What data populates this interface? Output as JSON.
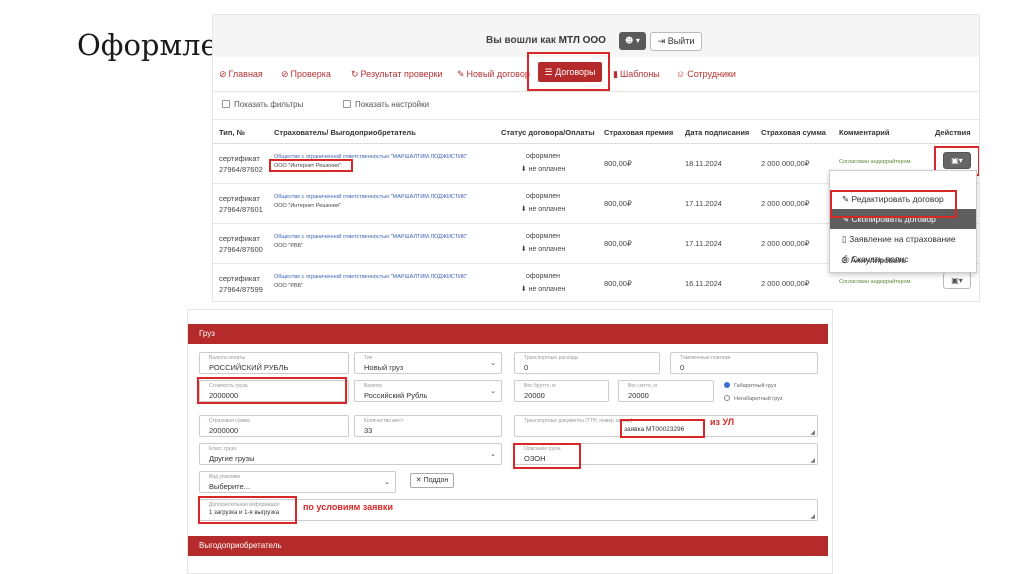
{
  "slide": {
    "title": "Оформление полиса"
  },
  "header": {
    "login_prefix": "Вы вошли как",
    "user_name": "МТЛ ООО",
    "user_icon": "☻ ▾",
    "logout_label": "Выйти"
  },
  "nav": {
    "items": [
      {
        "icon": "⊘",
        "label": "Главная"
      },
      {
        "icon": "⊘",
        "label": "Проверка"
      },
      {
        "icon": "↻",
        "label": "Результат проверки"
      },
      {
        "icon": "✎",
        "label": "Новый договор"
      },
      {
        "icon": "☰",
        "label": "Договоры"
      },
      {
        "icon": "▮",
        "label": "Шаблоны"
      },
      {
        "icon": "☺",
        "label": "Сотрудники"
      }
    ]
  },
  "filters": {
    "show_filters": "Показать фильтры",
    "show_settings": "Показать настройки"
  },
  "table": {
    "headers": [
      "Тип, №",
      "Страхователь/ Выгодоприобретатель",
      "Статус договора/Оплаты",
      "Страховая премия",
      "Дата подписания",
      "Страховая сумма",
      "Комментарий",
      "Действия"
    ],
    "rows": [
      {
        "type": "сертификат",
        "number": "27964/87602",
        "insurer": "Общество с ограниченной ответственностью \"МАРШАЛТИМ ЛОДЖИСТИК\"",
        "beneficiary": "ООО \"Интернет Решения\"",
        "status": "оформлен",
        "payment": "не оплачен",
        "premium": "800,00₽",
        "date": "18.11.2024",
        "sum": "2 000 000,00₽",
        "comment": "Согласован андеррайтером"
      },
      {
        "type": "сертификат",
        "number": "27964/87601",
        "insurer": "Общество с ограниченной ответственностью \"МАРШАЛТИМ ЛОДЖИСТИК\"",
        "beneficiary": "ООО \"Интернет Решения\"",
        "status": "оформлен",
        "payment": "не оплачен",
        "premium": "800,00₽",
        "date": "17.11.2024",
        "sum": "2 000 000,00₽",
        "comment": ""
      },
      {
        "type": "сертификат",
        "number": "27964/87600",
        "insurer": "Общество с ограниченной ответственностью \"МАРШАЛТИМ ЛОДЖИСТИК\"",
        "beneficiary": "ООО \"РВБ\"",
        "status": "оформлен",
        "payment": "не оплачен",
        "premium": "800,00₽",
        "date": "17.11.2024",
        "sum": "2 000 000,00₽",
        "comment": ""
      },
      {
        "type": "сертификат",
        "number": "27964/87599",
        "insurer": "Общество с ограниченной ответственностью \"МАРШАЛТИМ ЛОДЖИСТИК\"",
        "beneficiary": "ООО \"РВБ\"",
        "status": "оформлен",
        "payment": "не оплачен",
        "premium": "800,00₽",
        "date": "16.11.2024",
        "sum": "2 000 000,00₽",
        "comment": "Согласован андеррайтером"
      }
    ]
  },
  "actions_menu": {
    "items": [
      "Редактировать договор",
      "Скопировать договор",
      "Заявление на страхование",
      "Скачать полис",
      "Аннулировать"
    ]
  },
  "cargo_form": {
    "section_title": "Груз",
    "currency_label": "Валюта оплаты",
    "currency_value": "РОССИЙСКИЙ РУБЛЬ",
    "type_label": "Тип",
    "type_value": "Новый груз",
    "transport_label": "Транспортные расходы",
    "transport_value": "0",
    "customs_label": "Таможенные платежи",
    "customs_value": "0",
    "cost_label": "Стоимость груза",
    "cost_value": "2000000",
    "currency2_label": "Валюта",
    "currency2_value": "Российский Рубль",
    "gross_label": "Вес брутто, кг",
    "gross_value": "20000",
    "net_label": "Вес нетто, кг",
    "net_value": "20000",
    "radio_gabarit": "Габаритный груз",
    "radio_negabarit": "Негабаритный груз",
    "insured_sum_label": "Страховая сумма",
    "insured_sum_value": "2000000",
    "places_label": "Количество мест",
    "places_value": "33",
    "invoice_label": "Транспортные документы (ТТН, номер заявки)",
    "invoice_value": "заявка МТ00023296",
    "class_label": "Класс груза",
    "class_value": "Другие грузы",
    "desc_label": "Описание груза",
    "desc_value": "ОЗОН",
    "pack_label": "Вид упаковки",
    "pack_value": "Выберите...",
    "chip_label": "Поддон",
    "extra_label": "Дополнительная информация",
    "extra_value": "1 загрузка и 1-я выгрузка",
    "annot_ul": "из УЛ",
    "annot_terms": "по условиям заявки",
    "beneficiary_section": "Выгодоприобретатель"
  }
}
